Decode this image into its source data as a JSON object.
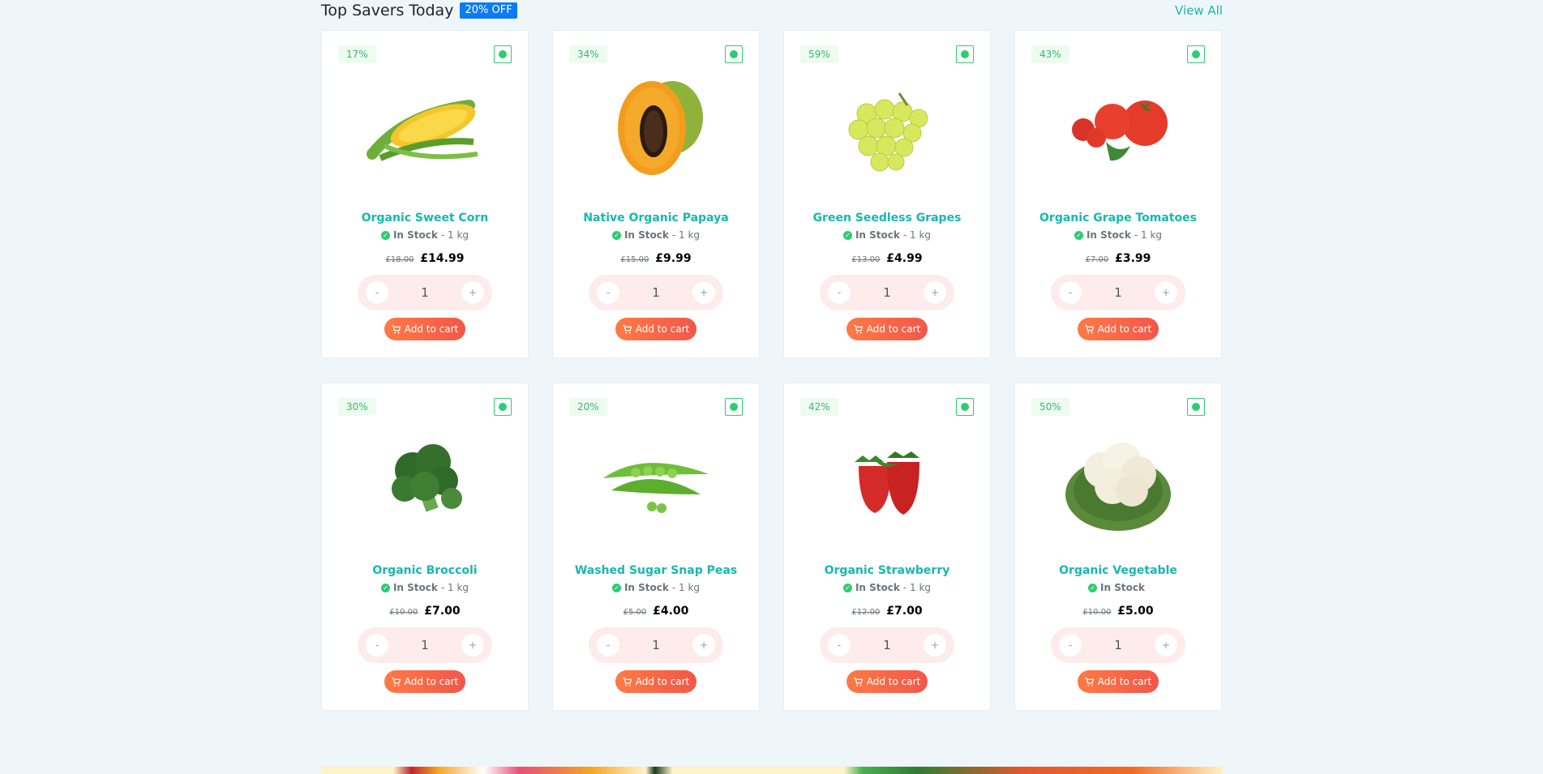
{
  "section": {
    "title": "Top Savers Today",
    "badge": "20% OFF",
    "view_all": "View All"
  },
  "products": [
    {
      "discount": "17%",
      "name": "Organic Sweet Corn",
      "stock": "In Stock",
      "unit": "- 1 kg",
      "old_price": "£18.00",
      "price": "£14.99",
      "qty": "1",
      "cart_label": "Add to cart",
      "image": "corn"
    },
    {
      "discount": "34%",
      "name": "Native Organic Papaya",
      "stock": "In Stock",
      "unit": "- 1 kg",
      "old_price": "£15.00",
      "price": "£9.99",
      "qty": "1",
      "cart_label": "Add to cart",
      "image": "papaya"
    },
    {
      "discount": "59%",
      "name": "Green Seedless Grapes",
      "stock": "In Stock",
      "unit": "- 1 kg",
      "old_price": "£13.00",
      "price": "£4.99",
      "qty": "1",
      "cart_label": "Add to cart",
      "image": "grapes"
    },
    {
      "discount": "43%",
      "name": "Organic Grape Tomatoes",
      "stock": "In Stock",
      "unit": "- 1 kg",
      "old_price": "£7.00",
      "price": "£3.99",
      "qty": "1",
      "cart_label": "Add to cart",
      "image": "tomatoes"
    },
    {
      "discount": "30%",
      "name": "Organic Broccoli",
      "stock": "In Stock",
      "unit": "- 1 kg",
      "old_price": "£10.00",
      "price": "£7.00",
      "qty": "1",
      "cart_label": "Add to cart",
      "image": "broccoli"
    },
    {
      "discount": "20%",
      "name": "Washed Sugar Snap Peas",
      "stock": "In Stock",
      "unit": "- 1 kg",
      "old_price": "£5.00",
      "price": "£4.00",
      "qty": "1",
      "cart_label": "Add to cart",
      "image": "peas"
    },
    {
      "discount": "42%",
      "name": "Organic Strawberry",
      "stock": "In Stock",
      "unit": "- 1 kg",
      "old_price": "£12.00",
      "price": "£7.00",
      "qty": "1",
      "cart_label": "Add to cart",
      "image": "strawberry"
    },
    {
      "discount": "50%",
      "name": "Organic Vegetable",
      "stock": "In Stock",
      "unit": "",
      "old_price": "£10.00",
      "price": "£5.00",
      "qty": "1",
      "cart_label": "Add to cart",
      "image": "cauliflower"
    }
  ],
  "qty_controls": {
    "minus": "-",
    "plus": "+"
  },
  "colors": {
    "accent": "#17b8b0",
    "cart": "#f2574a",
    "badge": "#0d7cf2",
    "veg": "#2ecc71"
  }
}
